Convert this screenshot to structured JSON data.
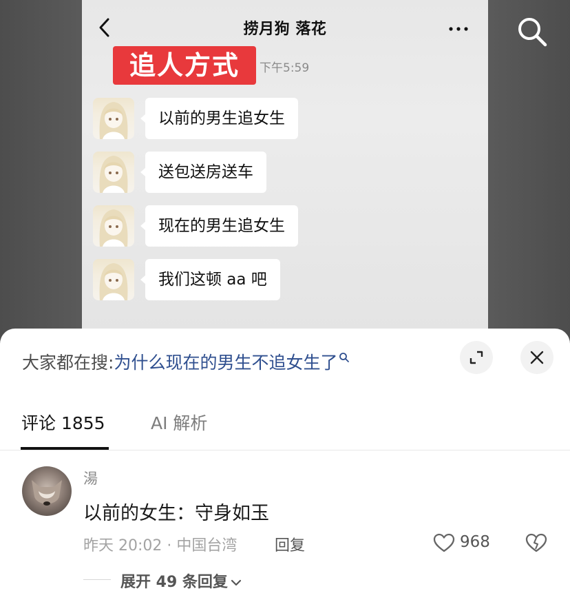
{
  "chat": {
    "title": "捞月狗 落花",
    "banner": "追人方式",
    "timestamp": "下午5:59",
    "messages": [
      "以前的男生追女生",
      "送包送房送车",
      "现在的男生追女生",
      "我们这顿 aa 吧"
    ]
  },
  "hot_search": {
    "prefix": "大家都在搜:",
    "query": "为什么现在的男生不追女生了"
  },
  "tabs": {
    "comments": "评论 1855",
    "ai": "AI 解析"
  },
  "comment": {
    "user": "湯",
    "text": "以前的女生：守身如玉",
    "meta": "昨天 20:02 · 中国台湾",
    "reply": "回复",
    "likes": "968",
    "expand": "展开 49 条回复"
  },
  "icons": {
    "back": "chevron-left-icon",
    "more": "more-dots-icon",
    "search": "search-icon",
    "expand_screen": "expand-icon",
    "close": "close-icon",
    "like": "heart-icon",
    "dislike": "broken-heart-icon"
  },
  "colors": {
    "banner": "#e8393c",
    "link": "#2f4f8f"
  }
}
